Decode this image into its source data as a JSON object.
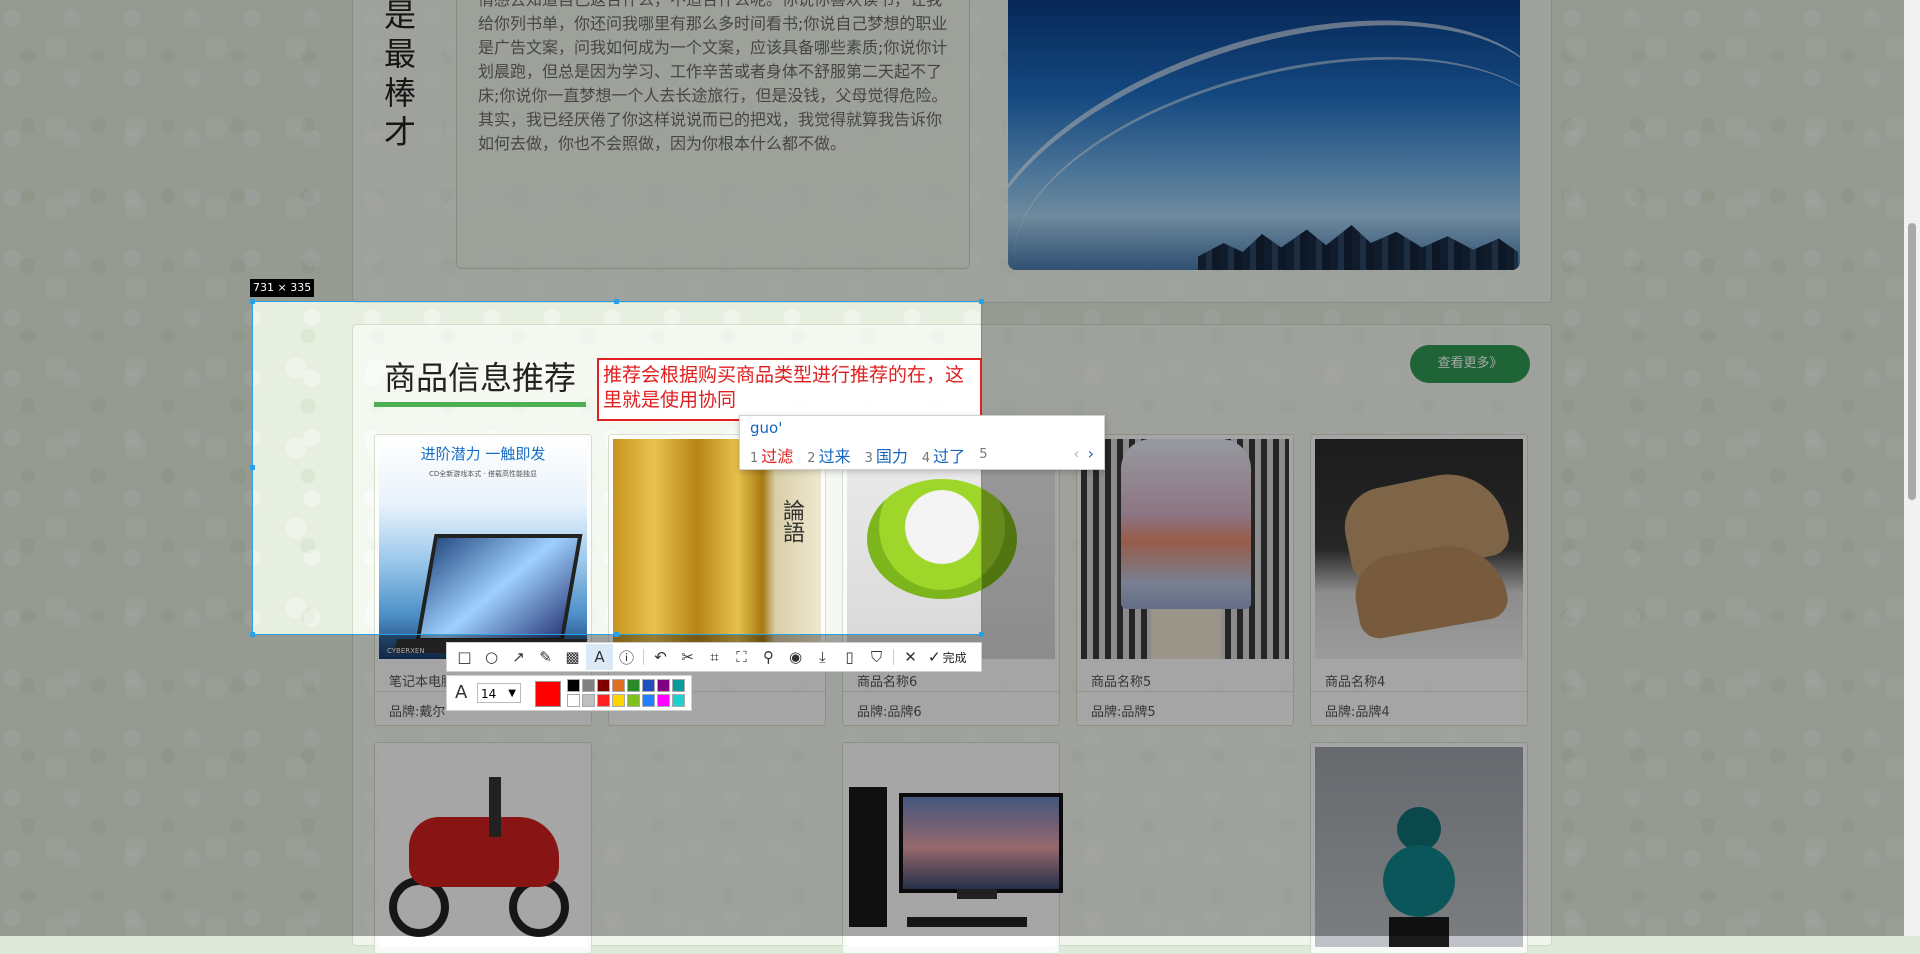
{
  "about": {
    "vertical_chars": [
      "是",
      "最",
      "棒",
      "才"
    ],
    "paragraph_lines": [
      "情感去知道自己返合什么，不适合什么呢。你说你喜欢读书，让我",
      "给你列书单，你还问我哪里有那么多时间看书;你说自己梦想的职业",
      "是广告文案，问我如何成为一个文案，应该具备哪些素质;你说你计",
      "划晨跑，但总是因为学习、工作辛苦或者身体不舒服第二天起不了",
      "床;你说你一直梦想一个人去长途旅行，但是没钱，父母觉得危险。",
      "其实，我已经厌倦了你这样说说而已的把戏，我觉得就算我告诉你",
      "如何去做，你也不会照做，因为你根本什么都不做。"
    ]
  },
  "section": {
    "title": "商品信息推荐",
    "more_label": "查看更多》"
  },
  "products": [
    {
      "name": "笔记本电脑",
      "brand": "品牌:戴尔",
      "banner": "进阶潜力 一触即发",
      "banner_sub": "CD全新游戏本式 · 搭载高性能独显",
      "laptop_tag": "CYBERXEN"
    },
    {
      "name": "",
      "brand": "",
      "book_char": "論語"
    },
    {
      "name": "商品名称6",
      "brand": "品牌:品牌6"
    },
    {
      "name": "商品名称5",
      "brand": "品牌:品牌5"
    },
    {
      "name": "商品名称4",
      "brand": "品牌:品牌4"
    }
  ],
  "capture": {
    "size_label": "731 × 335",
    "annotation_text": "推荐会根据购买商品类型进行推荐的在，这里就是使用协同",
    "font_size": "14",
    "done_label": "完成",
    "current_color": "#ff0000",
    "palette": [
      "#000000",
      "#808080",
      "#800000",
      "#e07020",
      "#2a8a2a",
      "#2050c0",
      "#800080",
      "#0a9a9a",
      "#ffffff",
      "#c0c0c0",
      "#ff2020",
      "#ffd700",
      "#80c020",
      "#2080ff",
      "#ff00ff",
      "#20d0d0"
    ],
    "tools": [
      "rect-icon",
      "ellipse-icon",
      "arrow-icon",
      "pen-icon",
      "mosaic-icon",
      "text-icon",
      "serial-icon",
      "undo-icon",
      "cut-icon",
      "ocr-icon",
      "scroll-capture-icon",
      "pin-icon",
      "record-icon",
      "download-icon",
      "save-icon",
      "bookmark-icon",
      "close-icon"
    ]
  },
  "ime": {
    "composition": "guo'",
    "candidates": [
      {
        "num": "1",
        "word": "过滤"
      },
      {
        "num": "2",
        "word": "过来"
      },
      {
        "num": "3",
        "word": "国力"
      },
      {
        "num": "4",
        "word": "过了"
      },
      {
        "num": "5",
        "word": ""
      }
    ],
    "prev": "‹",
    "next": "›"
  }
}
